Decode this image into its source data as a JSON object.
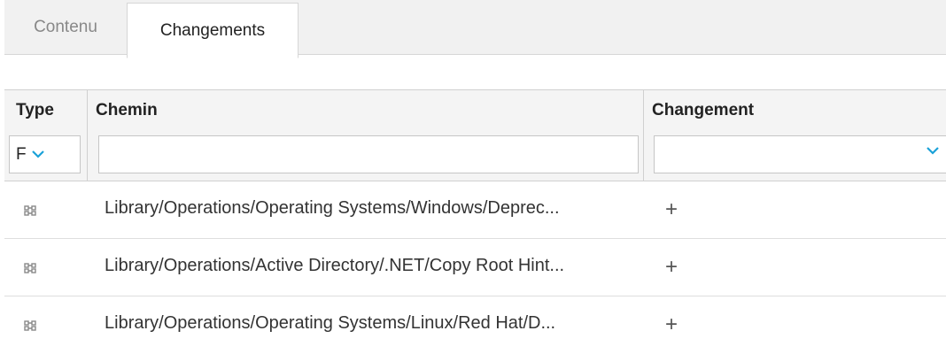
{
  "tabs": [
    {
      "label": "Contenu",
      "active": false
    },
    {
      "label": "Changements",
      "active": true
    }
  ],
  "table": {
    "columns": {
      "type": {
        "header": "Type",
        "filter_value": "F"
      },
      "chemin": {
        "header": "Chemin",
        "filter_value": ""
      },
      "changement": {
        "header": "Changement",
        "filter_value": ""
      }
    },
    "rows": [
      {
        "icon": "flow-icon",
        "path": "Library/Operations/Operating Systems/Windows/Deprec...",
        "change": "+"
      },
      {
        "icon": "flow-icon",
        "path": "Library/Operations/Active Directory/.NET/Copy Root Hint...",
        "change": "+"
      },
      {
        "icon": "flow-icon",
        "path": "Library/Operations/Operating Systems/Linux/Red Hat/D...",
        "change": "+"
      }
    ]
  },
  "colors": {
    "accent": "#1aa1d8"
  }
}
